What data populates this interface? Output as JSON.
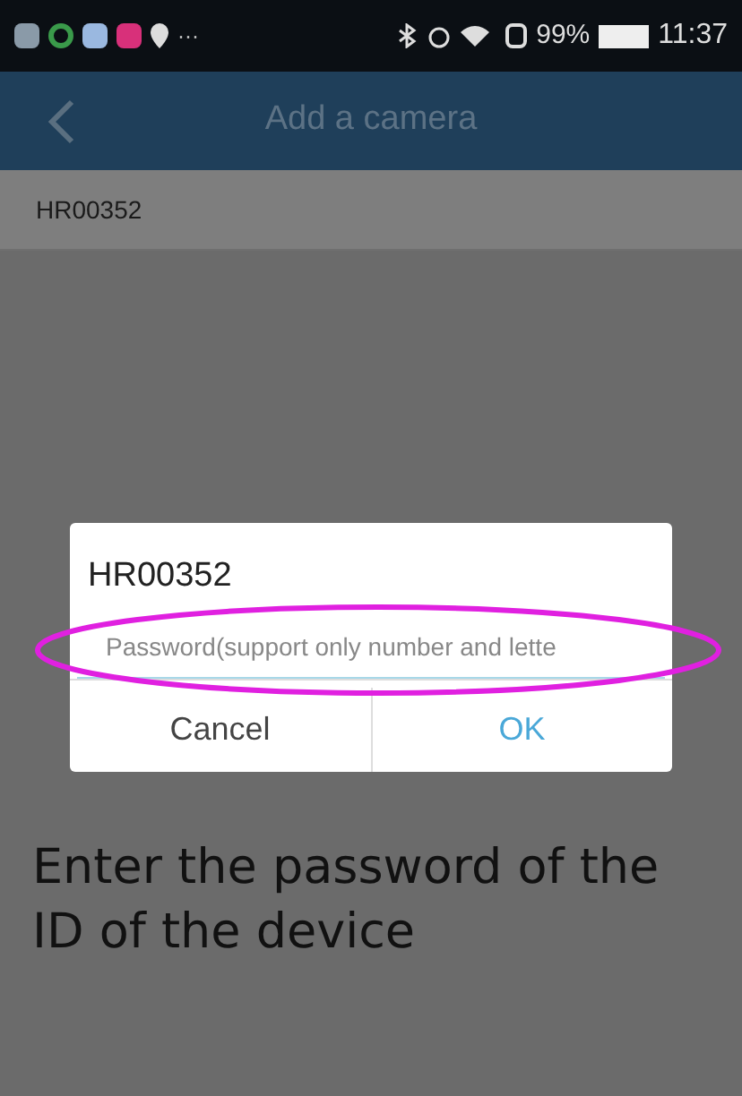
{
  "status_bar": {
    "overflow": "···",
    "battery_percent": "99%",
    "level": 0.99,
    "time": "11:37"
  },
  "header": {
    "title": "Add a camera"
  },
  "device_row": {
    "label": "HR00352"
  },
  "dialog": {
    "title": "HR00352",
    "password_placeholder": "Password(support only number and lette",
    "buttons": [
      {
        "label": "Cancel",
        "kind": "cancel"
      },
      {
        "label": "OK",
        "kind": "confirm"
      }
    ]
  },
  "caption": "Enter the password of the ID of the device"
}
